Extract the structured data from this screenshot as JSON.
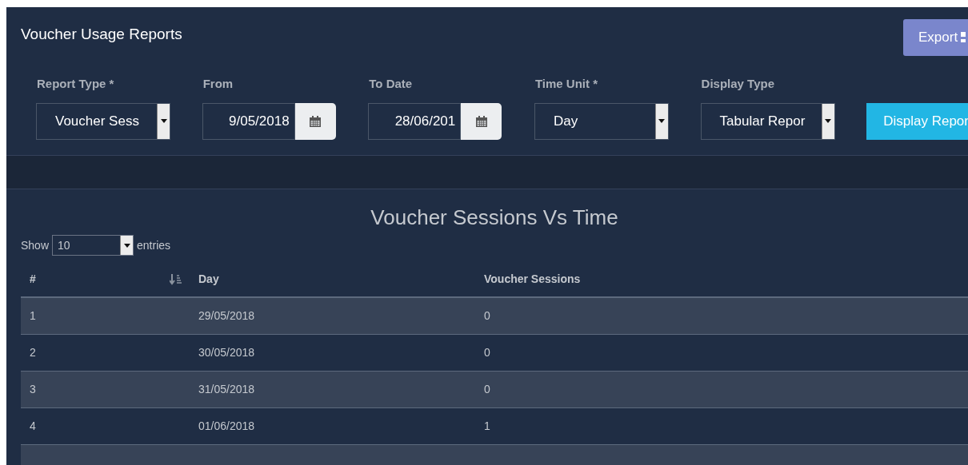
{
  "header": {
    "title": "Voucher Usage Reports",
    "export_button": "Export"
  },
  "filters": [
    {
      "kind": "select",
      "label": "Report Type *",
      "value": "Voucher Sess"
    },
    {
      "kind": "date",
      "label": "From",
      "value": "9/05/2018"
    },
    {
      "kind": "date",
      "label": "To Date",
      "value": "28/06/201"
    },
    {
      "kind": "select",
      "label": "Time Unit *",
      "value": "Day"
    },
    {
      "kind": "select",
      "label": "Display Type",
      "value": "Tabular Repor"
    }
  ],
  "display_button": "Display Repor",
  "report": {
    "title": "Voucher Sessions Vs Time",
    "show_label": "Show",
    "page_size": "10",
    "entries_label": "entries",
    "table": {
      "columns": [
        "#",
        "Day",
        "Voucher Sessions"
      ],
      "rows": [
        [
          "1",
          "29/05/2018",
          "0"
        ],
        [
          "2",
          "30/05/2018",
          "0"
        ],
        [
          "3",
          "31/05/2018",
          "0"
        ],
        [
          "4",
          "01/06/2018",
          "1"
        ]
      ]
    }
  }
}
